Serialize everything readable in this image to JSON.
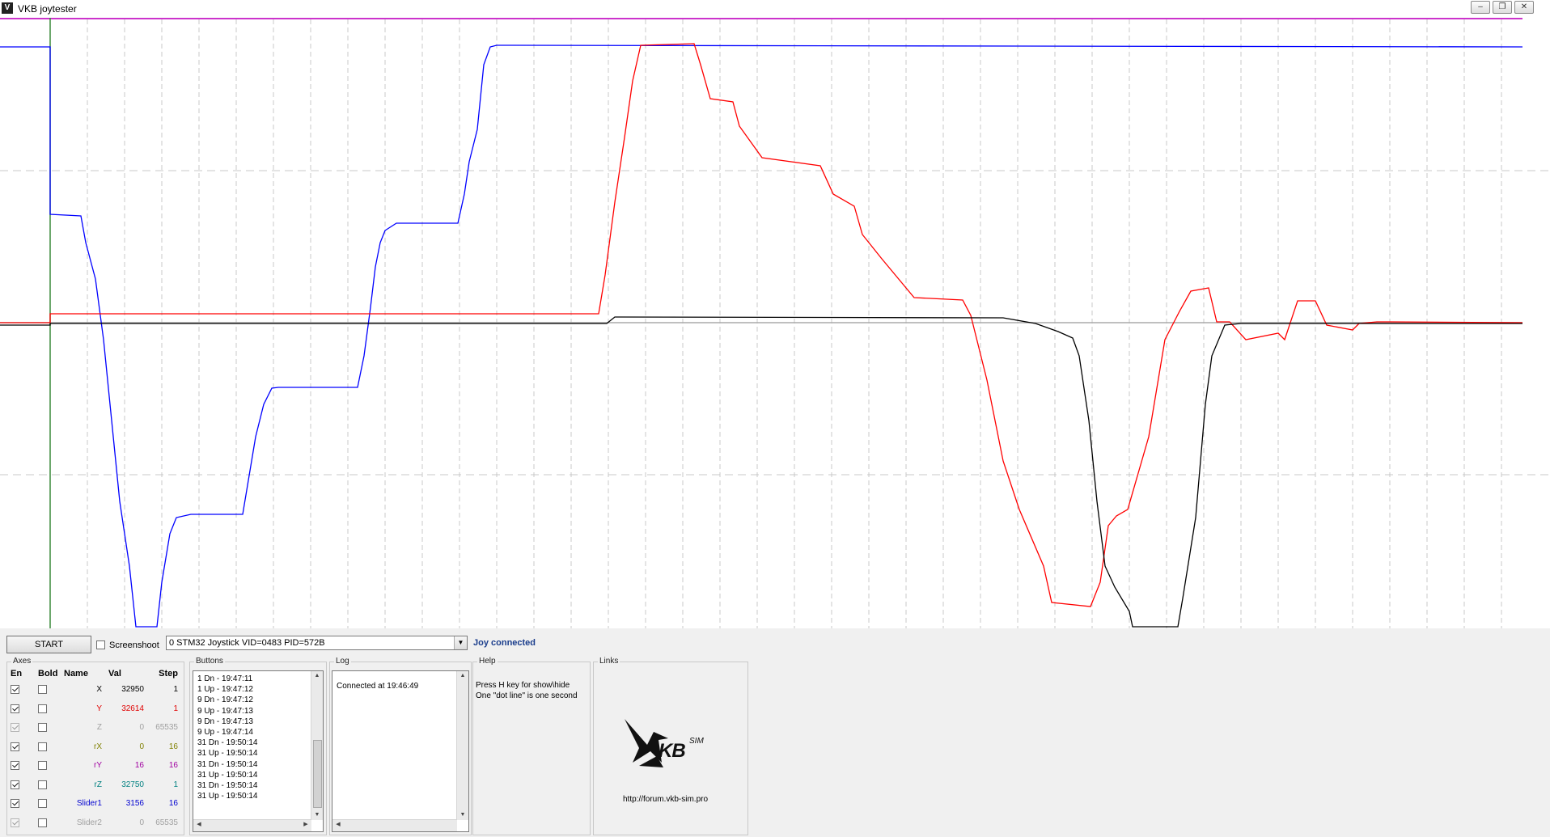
{
  "window": {
    "title": "VKB joytester",
    "minimize_icon": "minimize-icon",
    "maximize_icon": "restore-icon",
    "close_icon": "close-icon"
  },
  "plot": {
    "series_colors": {
      "x": "#ff0000",
      "slider1": "#0000ff",
      "ry": "#000000",
      "z": "#888888"
    }
  },
  "controls": {
    "start_label": "START",
    "screenshoot_label": "Screenshoot",
    "device_selected": "0 STM32 Joystick VID=0483 PID=572B",
    "status": "Joy connected"
  },
  "axes": {
    "group_label": "Axes",
    "headers": {
      "en": "En",
      "bold": "Bold",
      "name": "Name",
      "val": "Val",
      "step": "Step"
    },
    "rows": [
      {
        "en": true,
        "en_disabled": false,
        "name": "X",
        "val": "32950",
        "step": "1",
        "color": "#000000"
      },
      {
        "en": true,
        "en_disabled": false,
        "name": "Y",
        "val": "32614",
        "step": "1",
        "color": "#e00000"
      },
      {
        "en": true,
        "en_disabled": true,
        "name": "Z",
        "val": "0",
        "step": "65535",
        "color": "#a0a0a0"
      },
      {
        "en": true,
        "en_disabled": false,
        "name": "rX",
        "val": "0",
        "step": "16",
        "color": "#808000"
      },
      {
        "en": true,
        "en_disabled": false,
        "name": "rY",
        "val": "16",
        "step": "16",
        "color": "#a000a0"
      },
      {
        "en": true,
        "en_disabled": false,
        "name": "rZ",
        "val": "32750",
        "step": "1",
        "color": "#008080"
      },
      {
        "en": true,
        "en_disabled": false,
        "name": "Slider1",
        "val": "3156",
        "step": "16",
        "color": "#0000d0"
      },
      {
        "en": true,
        "en_disabled": true,
        "name": "Slider2",
        "val": "0",
        "step": "65535",
        "color": "#a0a0a0"
      }
    ]
  },
  "buttons_panel": {
    "label": "Buttons",
    "events": [
      "1 Dn - 19:47:11",
      "1 Up - 19:47:12",
      "9 Dn - 19:47:12",
      "9 Up - 19:47:13",
      "9 Dn - 19:47:13",
      "9 Up - 19:47:14",
      "31 Dn - 19:50:14",
      "31 Up - 19:50:14",
      "31 Dn - 19:50:14",
      "31 Up - 19:50:14",
      "31 Dn - 19:50:14",
      "31 Up - 19:50:14"
    ]
  },
  "log_panel": {
    "label": "Log",
    "lines": [
      "Connected at 19:46:49"
    ]
  },
  "help_panel": {
    "label": "Help",
    "line1": "Press H key for show\\hide",
    "line2": "One \"dot line\" is one second"
  },
  "links_panel": {
    "label": "Links",
    "logo_text": "KB",
    "logo_sup": "SIM",
    "url": "http://forum.vkb-sim.pro"
  }
}
